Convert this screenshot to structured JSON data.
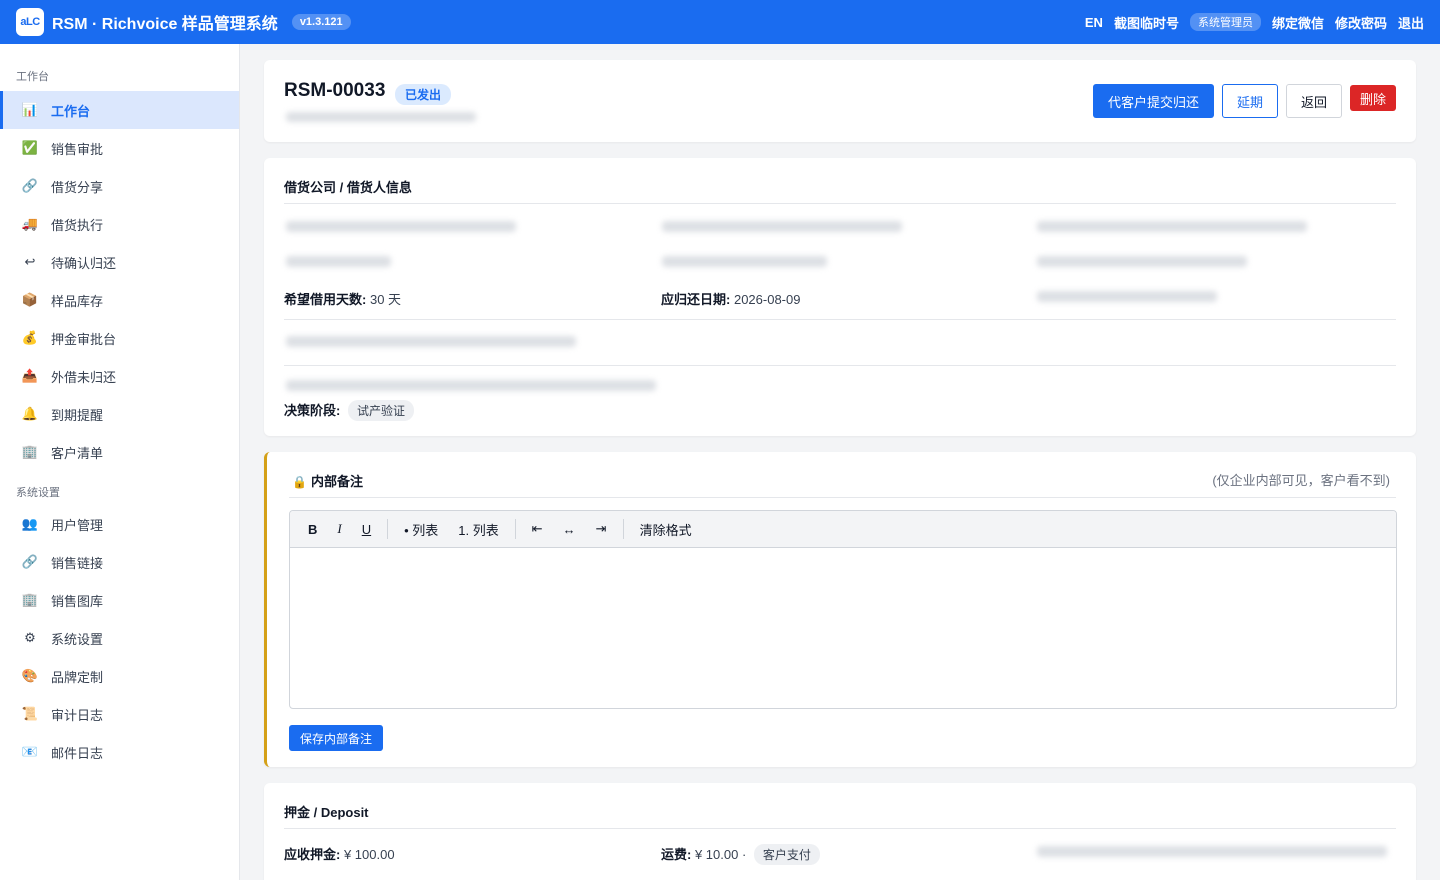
{
  "header": {
    "logo_text": "aLC",
    "title": "RSM · Richvoice 样品管理系统",
    "version": "v1.3.121",
    "links": {
      "lang": "EN",
      "screenshot": "截图临时号",
      "role": "系统管理员",
      "wechat": "绑定微信",
      "password": "修改密码",
      "logout": "退出"
    }
  },
  "sidebar": {
    "group1": "工作台",
    "group2": "系统设置",
    "items": [
      {
        "label": "工作台",
        "icon": "bar-chart-icon",
        "glyph": "📊"
      },
      {
        "label": "销售审批",
        "icon": "checkbox-icon",
        "glyph": "✅"
      },
      {
        "label": "借货分享",
        "icon": "link-icon",
        "glyph": "🔗"
      },
      {
        "label": "借货执行",
        "icon": "truck-icon",
        "glyph": "🚚"
      },
      {
        "label": "待确认归还",
        "icon": "return-icon",
        "glyph": "↩"
      },
      {
        "label": "样品库存",
        "icon": "package-icon",
        "glyph": "📦"
      },
      {
        "label": "押金审批台",
        "icon": "money-bag-icon",
        "glyph": "💰"
      },
      {
        "label": "外借未归还",
        "icon": "outbox-icon",
        "glyph": "📤"
      },
      {
        "label": "到期提醒",
        "icon": "bell-icon",
        "glyph": "🔔"
      },
      {
        "label": "客户清单",
        "icon": "building-icon",
        "glyph": "🏢"
      },
      {
        "label": "用户管理",
        "icon": "users-icon",
        "glyph": "👥"
      },
      {
        "label": "销售链接",
        "icon": "link-icon",
        "glyph": "🔗"
      },
      {
        "label": "销售图库",
        "icon": "building-icon",
        "glyph": "🏢"
      },
      {
        "label": "系统设置",
        "icon": "gear-icon",
        "glyph": "⚙"
      },
      {
        "label": "品牌定制",
        "icon": "palette-icon",
        "glyph": "🎨"
      },
      {
        "label": "审计日志",
        "icon": "scroll-icon",
        "glyph": "📜"
      },
      {
        "label": "邮件日志",
        "icon": "mail-icon",
        "glyph": "📧"
      }
    ]
  },
  "order": {
    "id": "RSM-00033",
    "status": "已发出",
    "actions": {
      "submit_return": "代客户提交归还",
      "extend": "延期",
      "back": "返回",
      "delete": "删除"
    }
  },
  "borrower": {
    "title": "借货公司 / 借货人信息",
    "days_label": "希望借用天数:",
    "days_value": "30 天",
    "due_label": "应归还日期:",
    "due_value": "2026-08-09",
    "stage_label": "决策阶段:",
    "stage_value": "试产验证"
  },
  "note": {
    "lock_glyph": "🔒",
    "title": "内部备注",
    "hint": "(仅企业内部可见，客户看不到)",
    "toolbar": {
      "bold": "B",
      "italic": "I",
      "underline": "U",
      "bullet": "• 列表",
      "numbered": "1. 列表",
      "outdent": "⇤",
      "center": "↔",
      "indent": "⇥",
      "clear": "清除格式"
    },
    "save": "保存内部备注"
  },
  "deposit": {
    "title": "押金 / Deposit",
    "amount_label": "应收押金:",
    "amount_value": "¥ 100.00",
    "shipping_label": "运费:",
    "shipping_value": "¥ 10.00 ·",
    "payer": "客户支付"
  },
  "colors": {
    "brand": "#1a6cf0",
    "danger": "#dc2626",
    "note_accent": "#d4a017"
  }
}
